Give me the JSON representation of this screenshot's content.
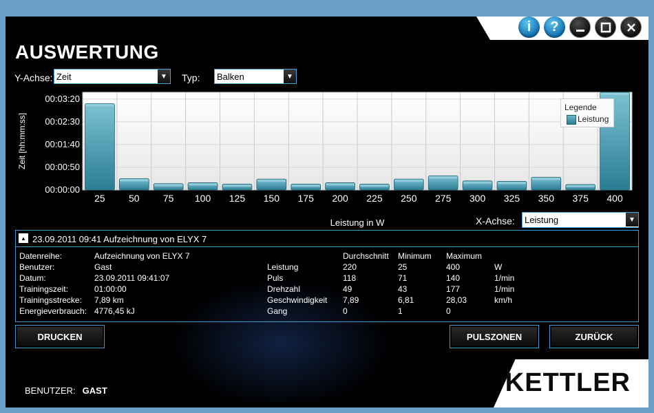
{
  "window": {
    "title": "AUSWERTUNG",
    "logo": "KETTLER",
    "buttons": {
      "info": "i",
      "help": "?"
    }
  },
  "controls": {
    "y_axis_label": "Y-Achse:",
    "y_axis_value": "Zeit",
    "type_label": "Typ:",
    "type_value": "Balken",
    "x_axis_label": "X-Achse:",
    "x_axis_value": "Leistung"
  },
  "chart_data": {
    "type": "bar",
    "xlabel": "Leistung in W",
    "ylabel": "Zeit [hh:mm:ss]",
    "y_ticks": [
      "00:00:00",
      "00:00:50",
      "00:01:40",
      "00:02:30",
      "00:03:20"
    ],
    "y_tick_values": [
      0,
      50,
      100,
      150,
      200
    ],
    "ylim": [
      0,
      215
    ],
    "categories": [
      "25",
      "50",
      "75",
      "100",
      "125",
      "150",
      "175",
      "200",
      "225",
      "250",
      "275",
      "300",
      "325",
      "350",
      "375",
      "400"
    ],
    "series": [
      {
        "name": "Leistung",
        "values": [
          190,
          25,
          14,
          16,
          13,
          24,
          13,
          16,
          13,
          24,
          31,
          20,
          19,
          28,
          12,
          215
        ]
      }
    ],
    "legend": {
      "title": "Legende",
      "position": "top-right"
    },
    "grid": true,
    "bar_color": "#3b8fa6"
  },
  "details": {
    "header": "23.09.2011 09:41 Aufzeichnung von ELYX 7",
    "info": [
      {
        "label": "Datenreihe:",
        "value": "Aufzeichnung von ELYX 7"
      },
      {
        "label": "Benutzer:",
        "value": "Gast"
      },
      {
        "label": "Datum:",
        "value": "23.09.2011 09:41:07"
      },
      {
        "label": "Trainingszeit:",
        "value": "01:00:00"
      },
      {
        "label": "Trainingsstrecke:",
        "value": "7,89 km"
      },
      {
        "label": "Energieverbrauch:",
        "value": "4776,45 kJ"
      }
    ],
    "stats_headers": [
      "Durchschnitt",
      "Minimum",
      "Maximum"
    ],
    "stats": [
      {
        "name": "Leistung",
        "avg": "220",
        "min": "25",
        "max": "400",
        "unit": "W"
      },
      {
        "name": "Puls",
        "avg": "118",
        "min": "71",
        "max": "140",
        "unit": "1/min"
      },
      {
        "name": "Drehzahl",
        "avg": "49",
        "min": "43",
        "max": "177",
        "unit": "1/min"
      },
      {
        "name": "Geschwindigkeit",
        "avg": "7,89",
        "min": "6,81",
        "max": "28,03",
        "unit": "km/h"
      },
      {
        "name": "Gang",
        "avg": "0",
        "min": "1",
        "max": "0",
        "unit": ""
      }
    ]
  },
  "actions": {
    "print": "DRUCKEN",
    "pulse_zones": "PULSZONEN",
    "back": "ZURÜCK"
  },
  "status": {
    "user_label": "BENUTZER:",
    "user_value": "GAST"
  }
}
